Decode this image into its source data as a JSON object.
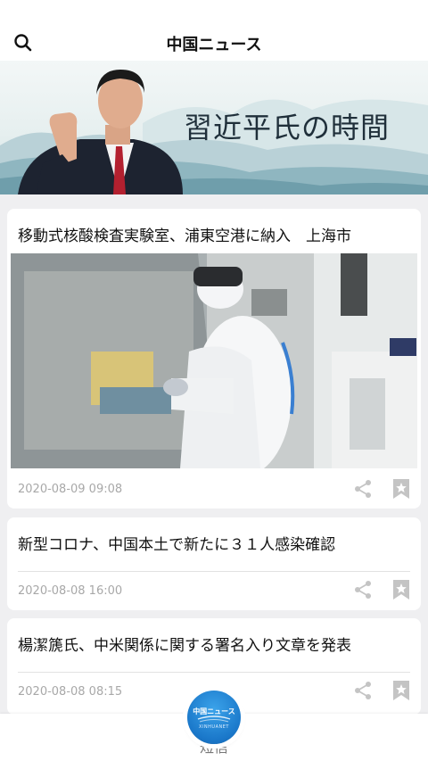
{
  "header": {
    "title": "中国ニュース",
    "search_icon": "search-icon"
  },
  "banner": {
    "title": "習近平氏の時間"
  },
  "articles": [
    {
      "title": "移動式核酸検査実験室、浦東空港に納入　上海市",
      "date": "2020-08-09 09:08"
    },
    {
      "title": "新型コロナ、中国本土で新たに３１人感染確認",
      "date": "2020-08-08 16:00"
    },
    {
      "title": "楊潔篪氏、中米関係に関する署名入り文章を発表",
      "date": "2020-08-08 08:15"
    }
  ],
  "tabbar": {
    "fab_label": "中国ニュース",
    "fab_sublabel": "XINHUANET",
    "under_text": "短信"
  },
  "colors": {
    "accent": "#1a77c9",
    "date_gray": "#a8a8a8",
    "icon_gray": "#c4c4c4",
    "background": "#efeff1"
  },
  "icons": [
    "search-icon",
    "share-icon",
    "bookmark-icon",
    "home-logo-icon"
  ]
}
